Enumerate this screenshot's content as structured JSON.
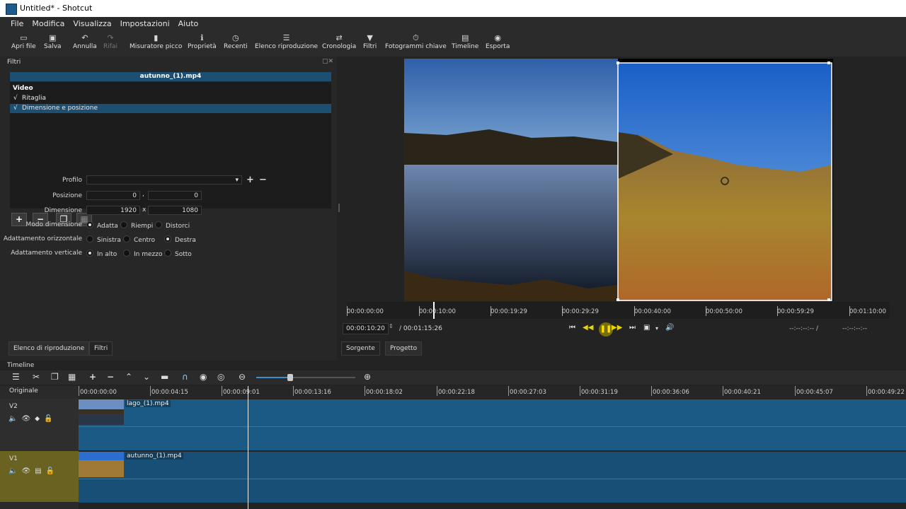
{
  "window": {
    "title": "Untitled* - Shotcut"
  },
  "menu": [
    "File",
    "Modifica",
    "Visualizza",
    "Impostazioni",
    "Aiuto"
  ],
  "toolbar": {
    "open": "Apri file",
    "save": "Salva",
    "undo": "Annulla",
    "redo": "Rifai",
    "peak": "Misuratore picco",
    "props": "Proprietà",
    "recent": "Recenti",
    "playlist": "Elenco riproduzione",
    "history": "Cronologia",
    "filters": "Filtri",
    "keyframes": "Fotogrammi chiave",
    "timeline": "Timeline",
    "export": "Esporta"
  },
  "filters": {
    "panel_title": "Filtri",
    "clip_name": "autunno_(1).mp4",
    "section": "Video",
    "items": [
      {
        "check": "√",
        "label": "Ritaglia"
      },
      {
        "check": "√",
        "label": "Dimensione e posizione"
      }
    ],
    "profile_label": "Profilo",
    "position_label": "Posizione",
    "pos_x": "0",
    "pos_sep": ",",
    "pos_y": "0",
    "size_label": "Dimensione",
    "size_w": "1920",
    "size_sep": "x",
    "size_h": "1080",
    "size_mode_label": "Modo dimensione",
    "size_mode": [
      "Adatta",
      "Riempi",
      "Distorci"
    ],
    "h_fit_label": "Adattamento orizzontale",
    "h_fit": [
      "Sinistra",
      "Centro",
      "Destra"
    ],
    "v_fit_label": "Adattamento verticale",
    "v_fit": [
      "In alto",
      "In mezzo",
      "Sotto"
    ]
  },
  "left_tabs": {
    "playlist": "Elenco di riproduzione",
    "filters": "Filtri"
  },
  "player": {
    "ruler": [
      "00:00:00:00",
      "00:00:10:00",
      "00:00:19:29",
      "00:00:29:29",
      "00:00:40:00",
      "00:00:50:00",
      "00:00:59:29",
      "00:01:10:00"
    ],
    "current_time": "00:00:10:20",
    "total_time": "/ 00:01:15:26",
    "in_point": "--:--:--:-- /",
    "out_point": "--:--:--:--",
    "tab_source": "Sorgente",
    "tab_project": "Progetto"
  },
  "timeline": {
    "title": "Timeline",
    "ruler": [
      "00:00:00:00",
      "00:00:04:15",
      "00:00:09:01",
      "00:00:13:16",
      "00:00:18:02",
      "00:00:22:18",
      "00:00:27:03",
      "00:00:31:19",
      "00:00:36:06",
      "00:00:40:21",
      "00:00:45:07",
      "00:00:49:22"
    ],
    "original_label": "Originale",
    "tracks": [
      {
        "name": "V2",
        "clip": "lago_(1).mp4"
      },
      {
        "name": "V1",
        "clip": "autunno_(1).mp4"
      }
    ]
  },
  "colors": {
    "accent": "#1d4f73",
    "track": "#1a5a85",
    "v1_header": "#6a6221"
  }
}
